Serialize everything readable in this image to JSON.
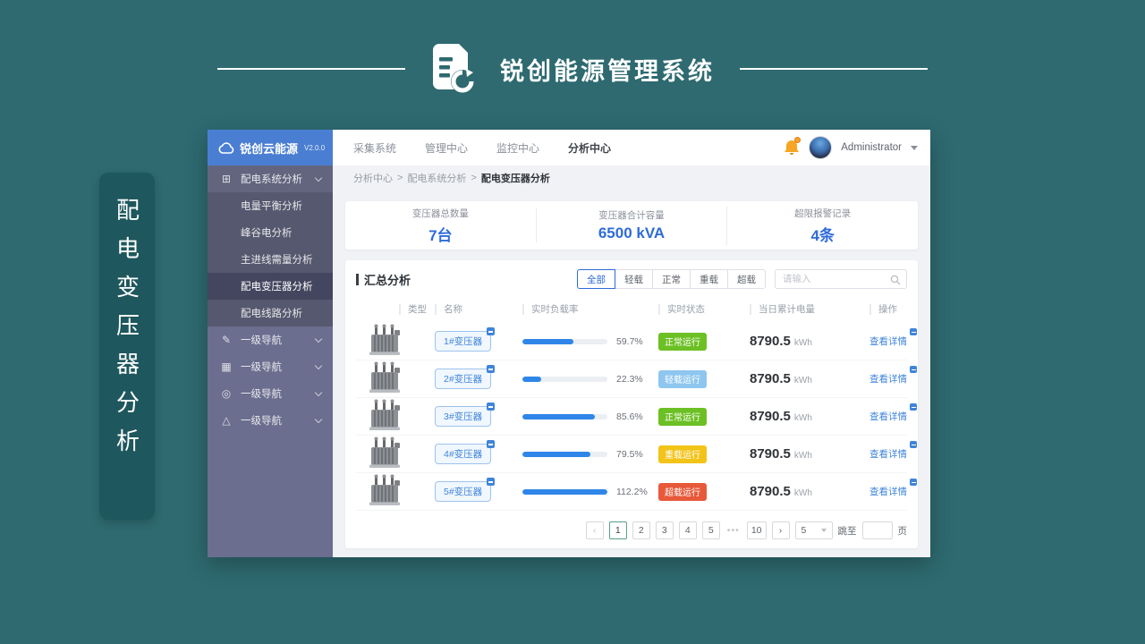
{
  "slide": {
    "title": "锐创能源管理系统",
    "side_banner_text": "配电变压器分析",
    "background_color": "#2e6a70",
    "banner_color": "#1e575d"
  },
  "sidebar": {
    "logo": {
      "name": "锐创云能源",
      "version": "V2.0.0",
      "icon": "cloud-icon"
    },
    "group": {
      "label": "配电系统分析",
      "icon_glyph": "⊞",
      "icon": "grid-plus-icon"
    },
    "subitems": [
      {
        "label": "电量平衡分析"
      },
      {
        "label": "峰谷电分析"
      },
      {
        "label": "主进线需量分析"
      },
      {
        "label": "配电变压器分析"
      },
      {
        "label": "配电线路分析"
      }
    ],
    "nav_items": [
      {
        "label": "一级导航",
        "icon_glyph": "✎",
        "icon": "edit-icon"
      },
      {
        "label": "一级导航",
        "icon_glyph": "▦",
        "icon": "grid-icon"
      },
      {
        "label": "一级导航",
        "icon_glyph": "◎",
        "icon": "check-circle-icon"
      },
      {
        "label": "一级导航",
        "icon_glyph": "△",
        "icon": "warning-icon"
      }
    ]
  },
  "topbar": {
    "tabs": [
      {
        "label": "采集系统"
      },
      {
        "label": "管理中心"
      },
      {
        "label": "监控中心"
      },
      {
        "label": "分析中心"
      }
    ],
    "user_name": "Administrator"
  },
  "breadcrumb": {
    "items": [
      "分析中心",
      "配电系统分析",
      "配电变压器分析"
    ],
    "separator": ">"
  },
  "stats": [
    {
      "label": "变压器总数量",
      "value": "7台"
    },
    {
      "label": "变压器合计容量",
      "value": "6500 kVA"
    },
    {
      "label": "超限报警记录",
      "value": "4条"
    }
  ],
  "summary": {
    "title": "汇总分析",
    "filters": [
      {
        "label": "全部"
      },
      {
        "label": "轻载"
      },
      {
        "label": "正常"
      },
      {
        "label": "重载"
      },
      {
        "label": "超载"
      }
    ],
    "search_placeholder": "请输入",
    "table": {
      "headers": [
        "类型",
        "名称",
        "实时负载率",
        "实时状态",
        "当日累计电量",
        "操作"
      ],
      "rows": [
        {
          "name": "1#变压器",
          "load": "59.7%",
          "bar": "59.7%",
          "status": "正常运行",
          "status_color": "#6cc024",
          "energy": "8790.5",
          "unit": "kWh",
          "action": "查看详情"
        },
        {
          "name": "2#变压器",
          "load": "22.3%",
          "bar": "22.3%",
          "status": "轻载运行",
          "status_color": "#8ec6ef",
          "energy": "8790.5",
          "unit": "kWh",
          "action": "查看详情"
        },
        {
          "name": "3#变压器",
          "load": "85.6%",
          "bar": "85.6%",
          "status": "正常运行",
          "status_color": "#6cc024",
          "energy": "8790.5",
          "unit": "kWh",
          "action": "查看详情"
        },
        {
          "name": "4#变压器",
          "load": "79.5%",
          "bar": "79.5%",
          "status": "重载运行",
          "status_color": "#f2c318",
          "energy": "8790.5",
          "unit": "kWh",
          "action": "查看详情"
        },
        {
          "name": "5#变压器",
          "load": "112.2%",
          "bar": "100%",
          "status": "超载运行",
          "status_color": "#e8593a",
          "energy": "8790.5",
          "unit": "kWh",
          "action": "查看详情"
        }
      ]
    },
    "pagination": {
      "prev": "‹",
      "pages": [
        "1",
        "2",
        "3",
        "4",
        "5"
      ],
      "ellipsis": "•••",
      "last": "10",
      "next": "›",
      "page_size": "5",
      "jump_label": "跳至",
      "jump_unit": "页"
    }
  },
  "colors": {
    "accent_blue": "#2e6bd9",
    "progress_blue": "#2f86e8",
    "status_normal": "#6cc024",
    "status_light": "#8ec6ef",
    "status_heavy": "#f2c318",
    "status_over": "#e8593a"
  }
}
